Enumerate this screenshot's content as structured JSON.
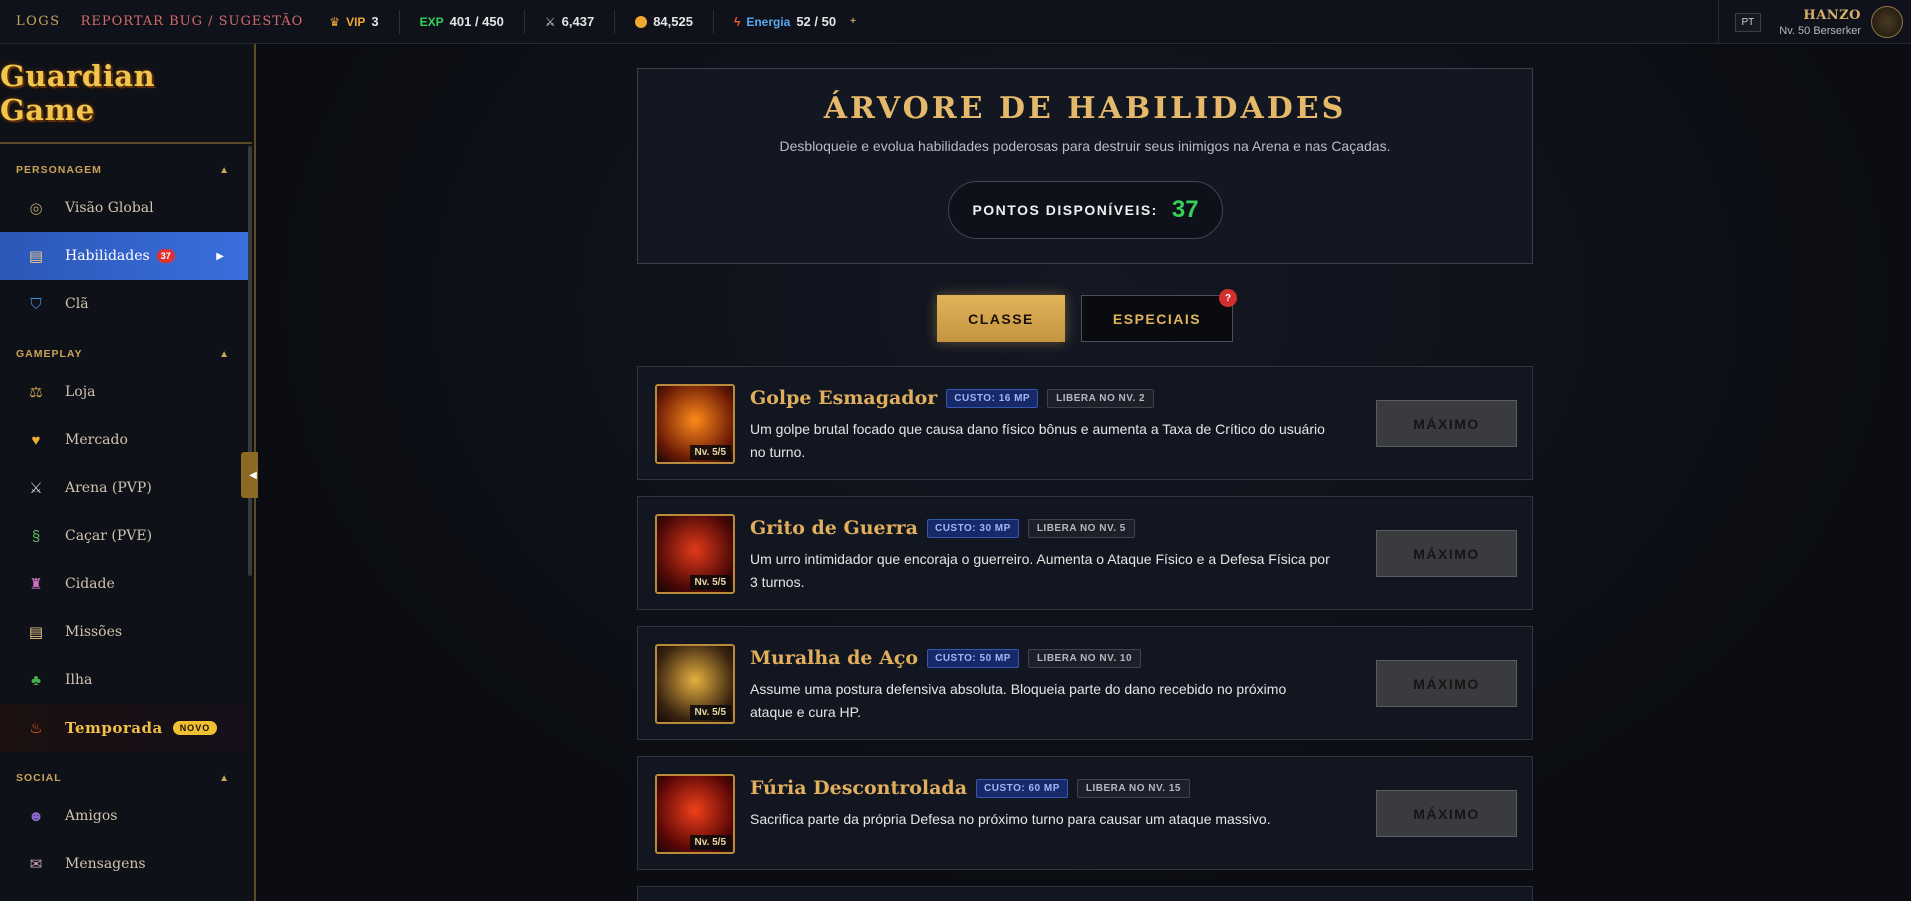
{
  "topbar": {
    "logs": "LOGS",
    "report": "REPORTAR BUG / SUGESTÃO",
    "vip_label": "VIP",
    "vip_value": "3",
    "exp_label": "EXP",
    "exp_value": "401 / 450",
    "power_value": "6,437",
    "gold_value": "84,525",
    "energy_label": "Energia",
    "energy_value": "52 / 50",
    "lang": "PT",
    "user_name": "HANZO",
    "user_level": "Nv. 50 Berserker"
  },
  "logo": "Guardian Game",
  "sidebar": {
    "sections": [
      {
        "title": "PERSONAGEM"
      },
      {
        "title": "GAMEPLAY"
      },
      {
        "title": "SOCIAL"
      }
    ],
    "personagem": [
      {
        "label": "Visão Global",
        "icon": "compass-icon"
      },
      {
        "label": "Habilidades",
        "icon": "scroll-icon",
        "badge": "37",
        "active": true
      },
      {
        "label": "Clã",
        "icon": "shield-icon"
      }
    ],
    "gameplay": [
      {
        "label": "Loja",
        "icon": "scales-icon"
      },
      {
        "label": "Mercado",
        "icon": "handshake-icon"
      },
      {
        "label": "Arena (PVP)",
        "icon": "swords-icon"
      },
      {
        "label": "Caçar (PVE)",
        "icon": "dragon-icon"
      },
      {
        "label": "Cidade",
        "icon": "castle-icon"
      },
      {
        "label": "Missões",
        "icon": "scroll-icon"
      },
      {
        "label": "Ilha",
        "icon": "island-icon"
      },
      {
        "label": "Temporada",
        "icon": "flame-icon",
        "badge": "NOVO"
      }
    ],
    "social": [
      {
        "label": "Amigos",
        "icon": "friends-icon"
      },
      {
        "label": "Mensagens",
        "icon": "mail-icon"
      }
    ]
  },
  "header": {
    "title": "ÁRVORE DE HABILIDADES",
    "subtitle": "Desbloqueie e evolua habilidades poderosas para destruir seus inimigos na Arena e nas Caçadas.",
    "points_label": "PONTOS DISPONÍVEIS:",
    "points_value": "37"
  },
  "tabs": {
    "classe": "CLASSE",
    "especiais": "ESPECIAIS",
    "especiais_badge": "?"
  },
  "skills": [
    {
      "name": "Golpe Esmagador",
      "cost": "CUSTO: 16 MP",
      "unlock": "LIBERA NO NV. 2",
      "desc": "Um golpe brutal focado que causa dano físico bônus e aumenta a Taxa de Crítico do usuário no turno.",
      "level": "Nv. 5/5",
      "button": "MÁXIMO",
      "colors": [
        "#ff8a1a",
        "#6a1a06"
      ]
    },
    {
      "name": "Grito de Guerra",
      "cost": "CUSTO: 30 MP",
      "unlock": "LIBERA NO NV. 5",
      "desc": "Um urro intimidador que encoraja o guerreiro. Aumenta o Ataque Físico e a Defesa Física por 3 turnos.",
      "level": "Nv. 5/5",
      "button": "MÁXIMO",
      "colors": [
        "#e23a1a",
        "#4a0806"
      ]
    },
    {
      "name": "Muralha de Aço",
      "cost": "CUSTO: 50 MP",
      "unlock": "LIBERA NO NV. 10",
      "desc": "Assume uma postura defensiva absoluta. Bloqueia parte do dano recebido no próximo ataque e cura HP.",
      "level": "Nv. 5/5",
      "button": "MÁXIMO",
      "colors": [
        "#e6b040",
        "#3a2410"
      ]
    },
    {
      "name": "Fúria Descontrolada",
      "cost": "CUSTO: 60 MP",
      "unlock": "LIBERA NO NV. 15",
      "desc": "Sacrifica parte da própria Defesa no próximo turno para causar um ataque massivo.",
      "level": "Nv. 5/5",
      "button": "MÁXIMO",
      "colors": [
        "#f0401a",
        "#5a0606"
      ]
    }
  ]
}
